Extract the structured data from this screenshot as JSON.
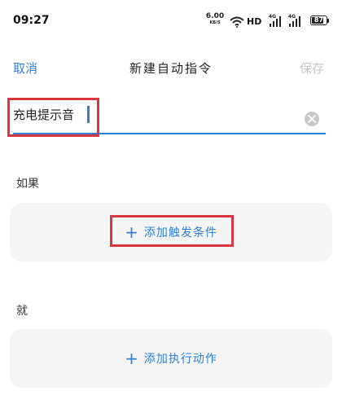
{
  "status_bar": {
    "time": "09:27",
    "net_speed_value": "6.00",
    "net_speed_unit": "KB/S",
    "hd_label": "HD",
    "signal1_label": "4G",
    "signal2_label": "4G",
    "battery_level": "87",
    "icons": [
      "wifi-icon",
      "signal-icon",
      "battery-icon"
    ]
  },
  "header": {
    "cancel_label": "取消",
    "title": "新建自动指令",
    "save_label": "保存"
  },
  "name_field": {
    "value": "充电提示音",
    "clear_icon": "clear-icon"
  },
  "if_section": {
    "label": "如果",
    "add_label": "添加触发条件"
  },
  "then_section": {
    "label": "就",
    "add_label": "添加执行动作"
  },
  "colors": {
    "accent": "#2f7fd6",
    "disabled": "#c8c8c8",
    "highlight": "#d9363e",
    "card_bg": "#f5f5f5"
  }
}
